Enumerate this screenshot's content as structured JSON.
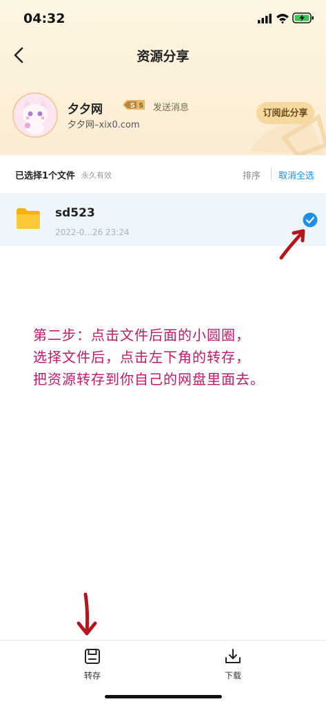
{
  "status_bar": {
    "time": "04:32"
  },
  "header": {
    "title": "资源分享"
  },
  "user": {
    "name": "夕夕网",
    "level": "5",
    "level_prefix": "S",
    "send_message": "发送消息",
    "site": "夕夕网–xix0.com",
    "subscribe_label": "订阅此分享"
  },
  "selection": {
    "count_label": "已选择1个文件",
    "validity": "永久有效",
    "sort_label": "排序",
    "cancel_all_label": "取消全选"
  },
  "files": [
    {
      "name": "sd523",
      "date": "2022-0...26 23:24",
      "selected": true
    }
  ],
  "annotation": {
    "line1": "第二步：点击文件后面的小圆圈，",
    "line2": "选择文件后，点击左下角的转存，",
    "line3": "把资源转存到你自己的网盘里面去。"
  },
  "bottom_bar": {
    "save_label": "转存",
    "download_label": "下载"
  },
  "colors": {
    "accent": "#1e8fe8",
    "annotation_text": "#c2186b",
    "annotation_arrow": "#b3161d",
    "header_bg": "#fcf1da",
    "subscribe_bg": "#f7d9a0",
    "folder": "#fcc419"
  }
}
